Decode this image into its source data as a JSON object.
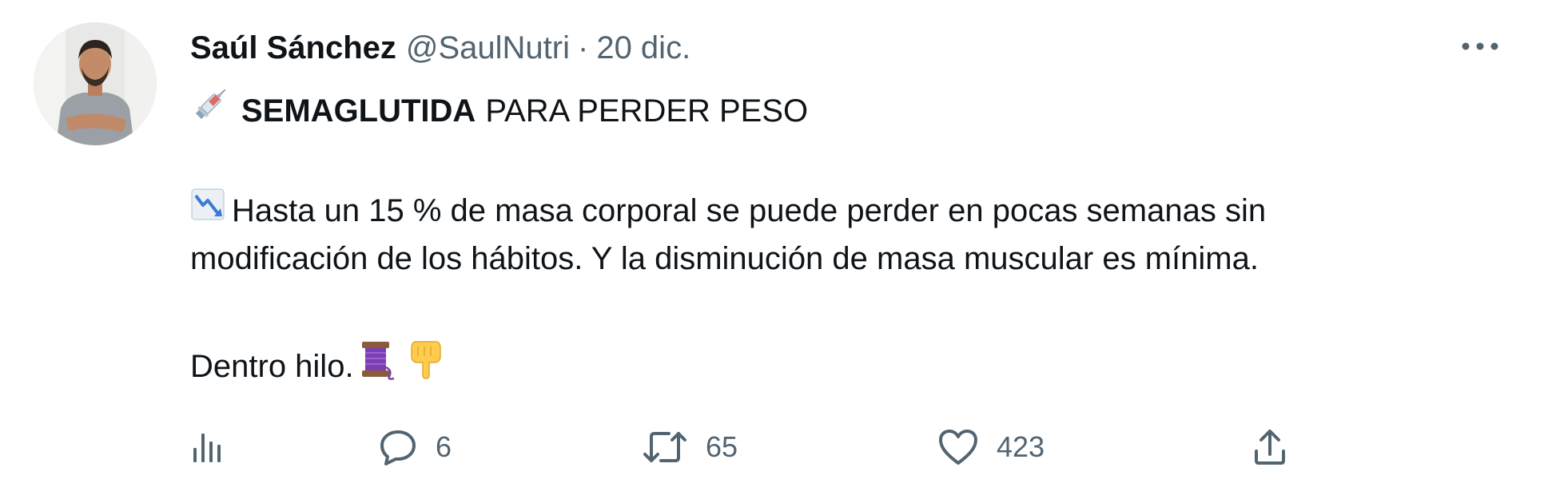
{
  "tweet": {
    "author": {
      "display_name": "Saúl Sánchez",
      "handle": "@SaulNutri",
      "separator": "·",
      "date": "20 dic."
    },
    "text": {
      "headline_emoji": "syringe-icon",
      "headline_bold": "SEMAGLUTIDA",
      "headline_rest": "PARA PERDER PESO",
      "para_emoji": "chart-decreasing-icon",
      "para_line1": "Hasta un 15 % de masa corporal se puede perder en pocas semanas sin",
      "para_line2": "modificación de los hábitos. Y la disminución de masa muscular es mínima.",
      "thread_text": "Dentro hilo.",
      "thread_emojis": [
        "thread-spool-icon",
        "pointing-down-icon"
      ]
    },
    "actions": {
      "views_icon": "bar-chart-icon",
      "replies_count": "6",
      "retweets_count": "65",
      "likes_count": "423",
      "share_icon": "share-icon"
    },
    "colors": {
      "primary_text": "#0f1419",
      "secondary_text": "#536471",
      "background": "#ffffff"
    }
  }
}
